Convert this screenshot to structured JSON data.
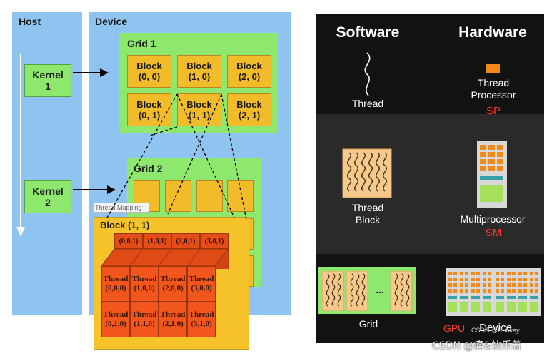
{
  "left": {
    "host_label": "Host",
    "device_label": "Device",
    "kernel1": [
      "Kernel",
      "1"
    ],
    "kernel2": [
      "Kernel",
      "2"
    ],
    "grid1_label": "Grid 1",
    "grid1_blocks": [
      [
        "Block",
        "(0, 0)"
      ],
      [
        "Block",
        "(1, 0)"
      ],
      [
        "Block",
        "(2, 0)"
      ],
      [
        "Block",
        "(0, 1)"
      ],
      [
        "Block",
        "(1, 1)"
      ],
      [
        "Block",
        "(2, 1)"
      ]
    ],
    "grid2_label": "Grid 2",
    "thread_mapping": "Thread Mapping",
    "block11_label": "Block (1, 1)",
    "top_labels": [
      "(0,0,1)",
      "(1,0,1)",
      "(2,0,1)",
      "(3,0,1)"
    ],
    "threads_row0": [
      [
        "Thread",
        "(0,0,0)"
      ],
      [
        "Thread",
        "(1,0,0)"
      ],
      [
        "Thread",
        "(2,0,0)"
      ],
      [
        "Thread",
        "(3,0,0)"
      ]
    ],
    "threads_row1": [
      [
        "Thread",
        "(0,1,0)"
      ],
      [
        "Thread",
        "(1,1,0)"
      ],
      [
        "Thread",
        "(2,1,0)"
      ],
      [
        "Thread",
        "(3,1,0)"
      ]
    ]
  },
  "right": {
    "software_title": "Software",
    "hardware_title": "Hardware",
    "thread_label": "Thread",
    "thread_processor": [
      "Thread",
      "Processor"
    ],
    "sp": "SP",
    "thread_block": [
      "Thread",
      "Block"
    ],
    "multiprocessor": "Multiprocessor",
    "sm": "SM",
    "grid_label": "Grid",
    "ellipsis": "...",
    "gpu": "GPU",
    "device": "Device"
  },
  "watermark": {
    "line1": "CSDN @Ruokay",
    "line2": "CSDN @痛&快乐着"
  },
  "colors": {
    "host_blue": "#8fc3f0",
    "green": "#8fe86e",
    "block_orange": "#f2bb2a",
    "thread_red_orange": "#f2561d",
    "dark_panel": "#121212",
    "accent_red": "#ff3a2a"
  }
}
